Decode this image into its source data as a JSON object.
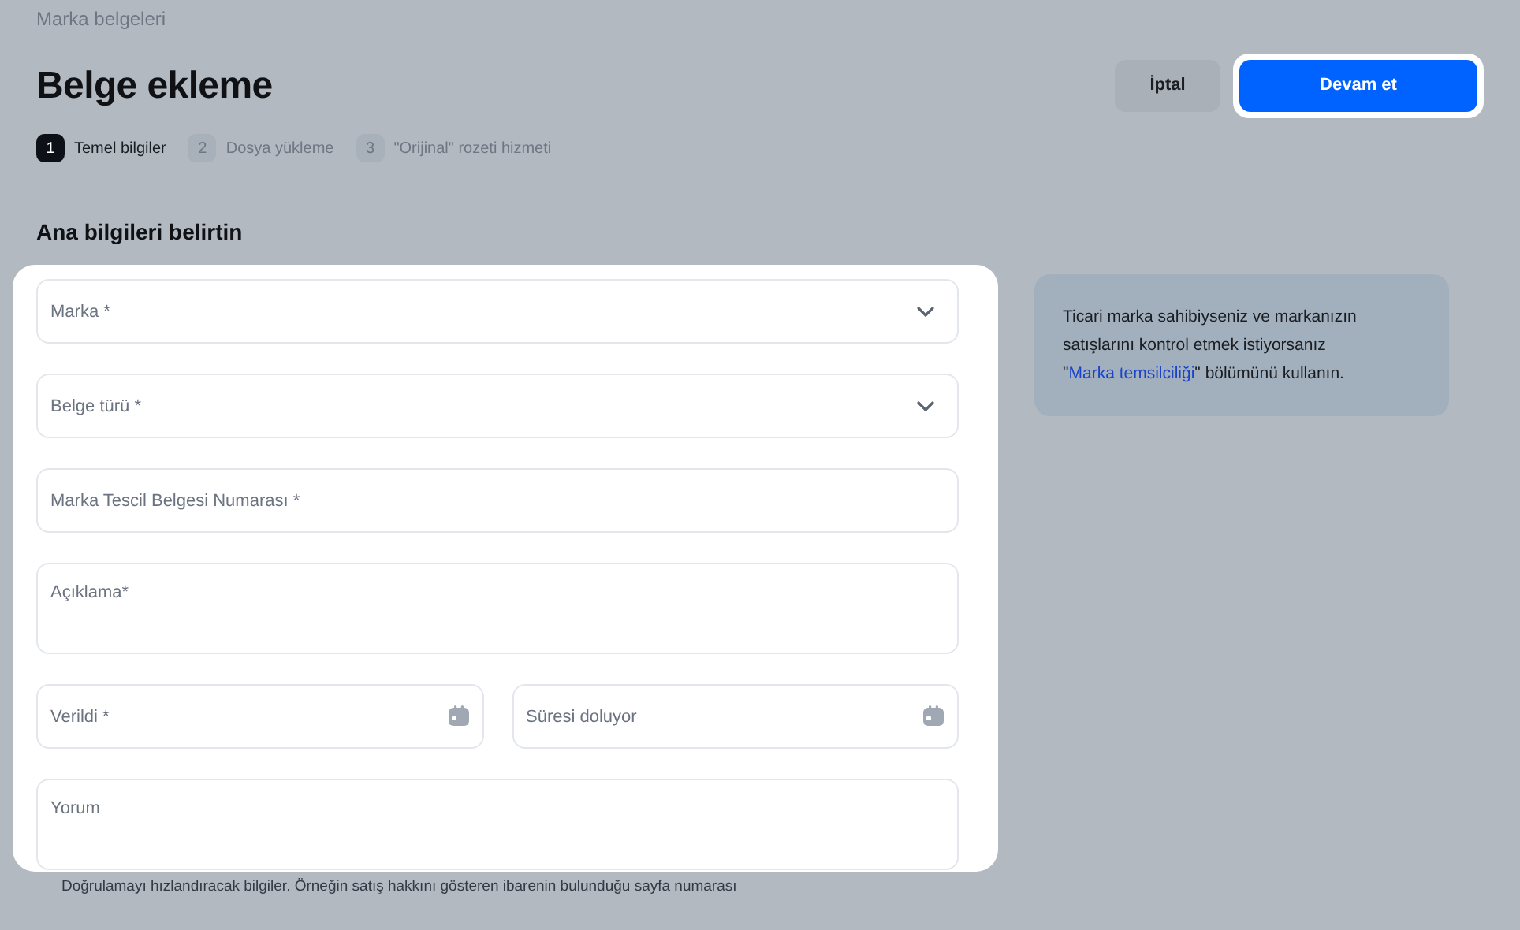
{
  "breadcrumb": "Marka belgeleri",
  "title": "Belge ekleme",
  "buttons": [
    {
      "label": "İptal",
      "kind": "secondary"
    },
    {
      "label": "Devam et",
      "kind": "primary"
    }
  ],
  "steps": [
    {
      "number": "1",
      "label": "Temel bilgiler",
      "selected": true
    },
    {
      "number": "2",
      "label": "Dosya yükleme",
      "selected": false
    },
    {
      "number": "3",
      "label": "\"Orijinal\" rozeti hizmeti",
      "selected": false
    }
  ],
  "section_title": "Ana bilgileri belirtin",
  "fields": [
    {
      "kind": "select",
      "placeholder": "Marka *"
    },
    {
      "kind": "select",
      "placeholder": "Belge türü *"
    },
    {
      "kind": "text",
      "placeholder": "Marka Tescil Belgesi Numarası *"
    },
    {
      "kind": "textarea",
      "placeholder": "Açıklama*"
    },
    {
      "kind": "date_pair",
      "items": [
        {
          "placeholder": "Verildi *"
        },
        {
          "placeholder": "Süresi doluyor"
        }
      ]
    },
    {
      "kind": "textarea",
      "placeholder": "Yorum",
      "hint": "Doğrulamayı hızlandıracak bilgiler. Örneğin satış hakkını gösteren ibarenin bulunduğu sayfa numarası"
    }
  ],
  "info": {
    "text": "Ticari marka sahibiyseniz ve markanızın satışlarını kontrol etmek istiyorsanız \"",
    "link": "Marka temsilciliği",
    "text_after": "\" bölümünü kullanın."
  }
}
